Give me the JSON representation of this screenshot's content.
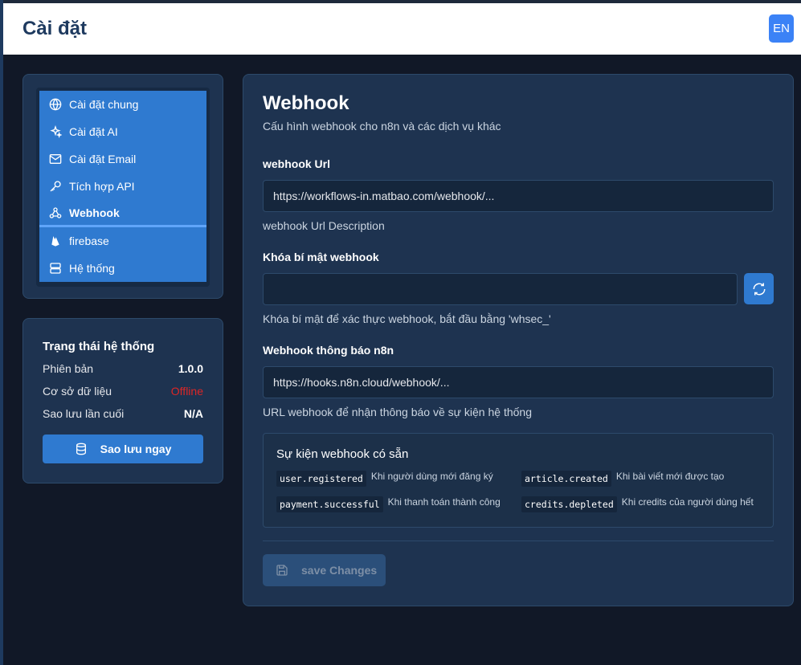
{
  "header": {
    "title": "Cài đặt",
    "lang": "EN"
  },
  "sidebar": {
    "items": [
      {
        "label": "Cài đặt chung",
        "icon": "globe-icon"
      },
      {
        "label": "Cài đặt AI",
        "icon": "sparkles-icon"
      },
      {
        "label": "Cài đặt Email",
        "icon": "mail-icon"
      },
      {
        "label": "Tích hợp API",
        "icon": "key-icon"
      },
      {
        "label": "Webhook",
        "icon": "webhook-icon",
        "active": true
      },
      {
        "label": "firebase",
        "icon": "firebase-icon"
      },
      {
        "label": "Hệ thống",
        "icon": "server-icon"
      }
    ]
  },
  "status": {
    "title": "Trạng thái hệ thống",
    "version_label": "Phiên bản",
    "version_value": "1.0.0",
    "db_label": "Cơ sở dữ liệu",
    "db_value": "Offline",
    "backup_label": "Sao lưu lần cuối",
    "backup_value": "N/A",
    "backup_button": "Sao lưu ngay"
  },
  "main": {
    "title": "Webhook",
    "subtitle": "Cấu hình webhook cho n8n và các dịch vụ khác",
    "webhook_url": {
      "label": "webhook Url",
      "value": "https://workflows-in.matbao.com/webhook/...",
      "description": "webhook Url Description"
    },
    "secret": {
      "label": "Khóa bí mật webhook",
      "value": "",
      "description": "Khóa bí mật để xác thực webhook, bắt đầu bằng 'whsec_'"
    },
    "n8n": {
      "label": "Webhook thông báo n8n",
      "value": "https://hooks.n8n.cloud/webhook/...",
      "description": "URL webhook để nhận thông báo về sự kiện hệ thống"
    },
    "events": {
      "title": "Sự kiện webhook có sẵn",
      "list": [
        {
          "code": "user.registered",
          "desc": "Khi người dùng mới đăng ký"
        },
        {
          "code": "article.created",
          "desc": "Khi bài viết mới được tạo"
        },
        {
          "code": "payment.successful",
          "desc": "Khi thanh toán thành công"
        },
        {
          "code": "credits.depleted",
          "desc": "Khi credits của người dùng hết"
        }
      ]
    },
    "save_button": "save Changes"
  },
  "colors": {
    "accent": "#2f7ad0",
    "offline": "#dc2626",
    "background": "#111827"
  }
}
